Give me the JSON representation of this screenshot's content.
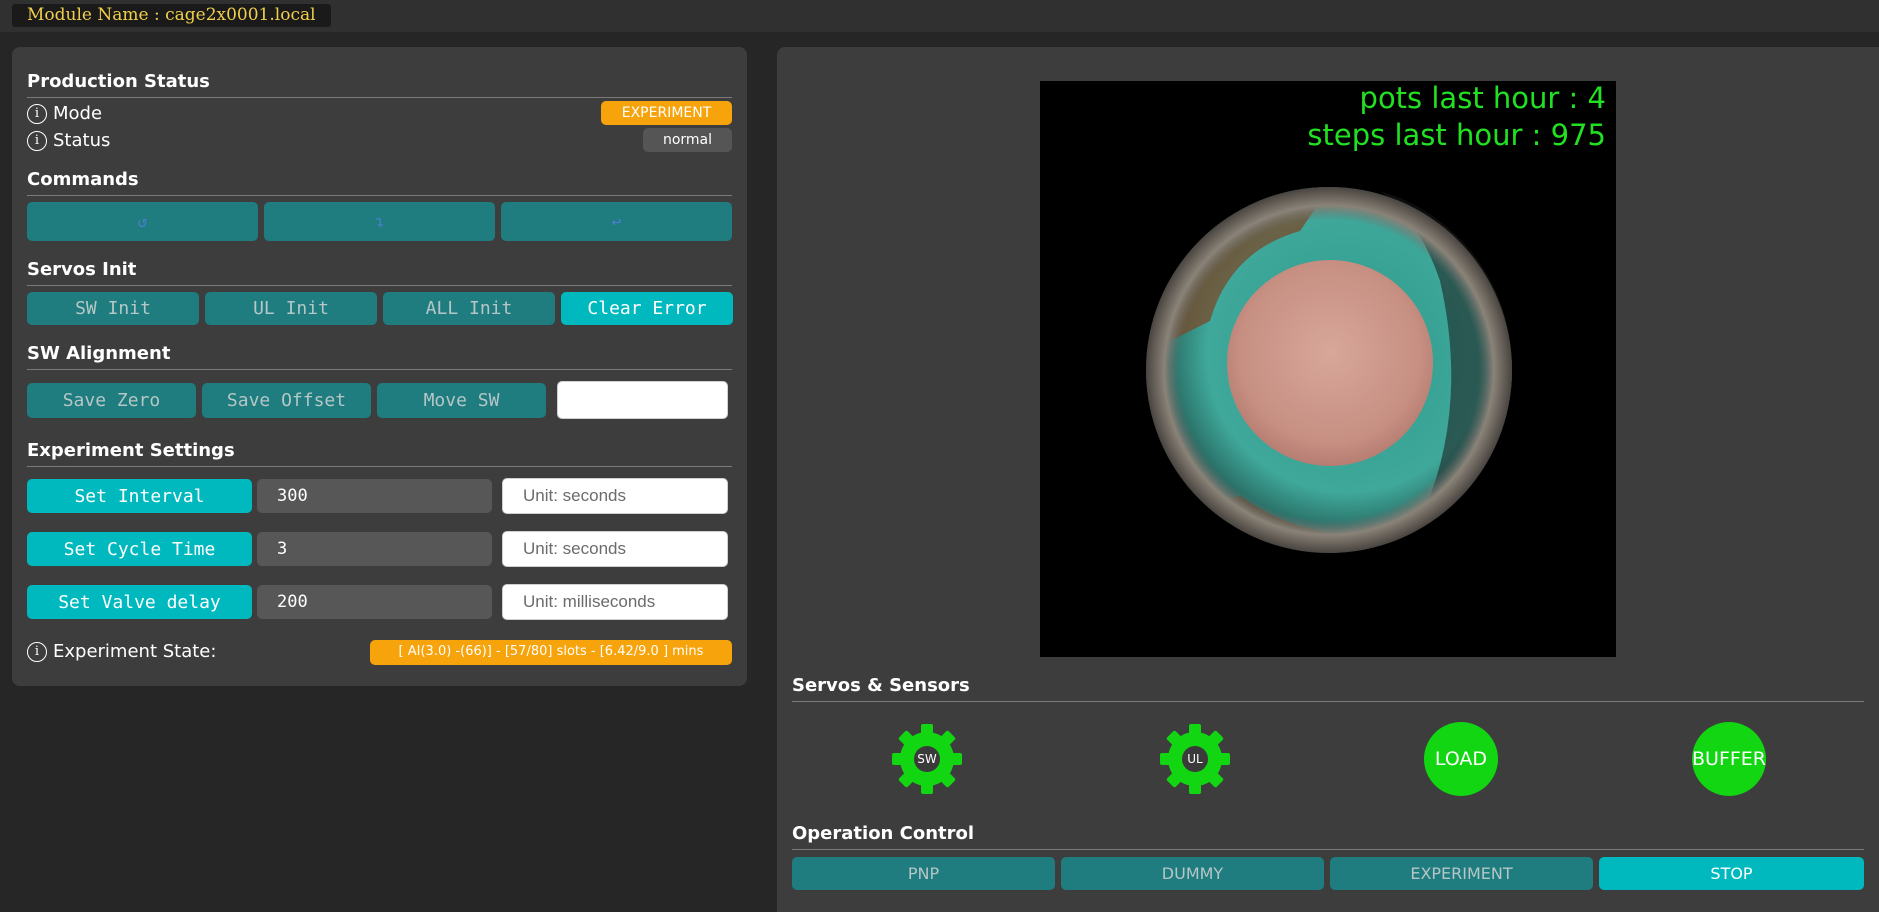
{
  "module": {
    "name": "Module Name : cage2x0001.local"
  },
  "production": {
    "title": "Production Status",
    "mode_label": "Mode",
    "mode_value": "EXPERIMENT",
    "status_label": "Status",
    "status_value": "normal"
  },
  "commands": {
    "title": "Commands",
    "buttons": [
      {
        "icon": "rotate-ccw-icon",
        "glyph": "↺"
      },
      {
        "icon": "turn-down-icon",
        "glyph": "↴"
      },
      {
        "icon": "return-icon",
        "glyph": "↩"
      }
    ]
  },
  "servos_init": {
    "title": "Servos Init",
    "buttons": [
      "SW Init",
      "UL Init",
      "ALL Init",
      "Clear Error"
    ]
  },
  "sw_alignment": {
    "title": "SW Alignment",
    "buttons": [
      "Save Zero",
      "Save Offset",
      "Move SW"
    ],
    "input_value": ""
  },
  "experiment_settings": {
    "title": "Experiment Settings",
    "rows": [
      {
        "button": "Set Interval",
        "value": "300",
        "unit_placeholder": "Unit: seconds"
      },
      {
        "button": "Set Cycle Time",
        "value": "3",
        "unit_placeholder": "Unit: seconds"
      },
      {
        "button": "Set Valve delay",
        "value": "200",
        "unit_placeholder": "Unit: milliseconds"
      }
    ],
    "state_label": "Experiment State:",
    "state_value": "[ AI(3.0) -(66)] - [57/80] slots - [6.42/9.0 ] mins"
  },
  "camera": {
    "overlay_line1": "pots last hour : 4",
    "overlay_line2": "steps last hour : 975"
  },
  "servos_sensors": {
    "title": "Servos & Sensors",
    "items": [
      {
        "label": "SW",
        "shape": "gear",
        "color": "#11d611"
      },
      {
        "label": "UL",
        "shape": "gear",
        "color": "#11d611"
      },
      {
        "label": "LOAD",
        "shape": "circle",
        "color": "#11d611"
      },
      {
        "label": "BUFFER",
        "shape": "circle",
        "color": "#11d611"
      }
    ]
  },
  "operation_control": {
    "title": "Operation Control",
    "buttons": [
      "PNP",
      "DUMMY",
      "EXPERIMENT",
      "STOP"
    ]
  },
  "colors": {
    "accent_teal": "#00b9bf",
    "dim_teal": "#1f7c7f",
    "orange": "#f7a30b",
    "sensor_green": "#11d611"
  }
}
